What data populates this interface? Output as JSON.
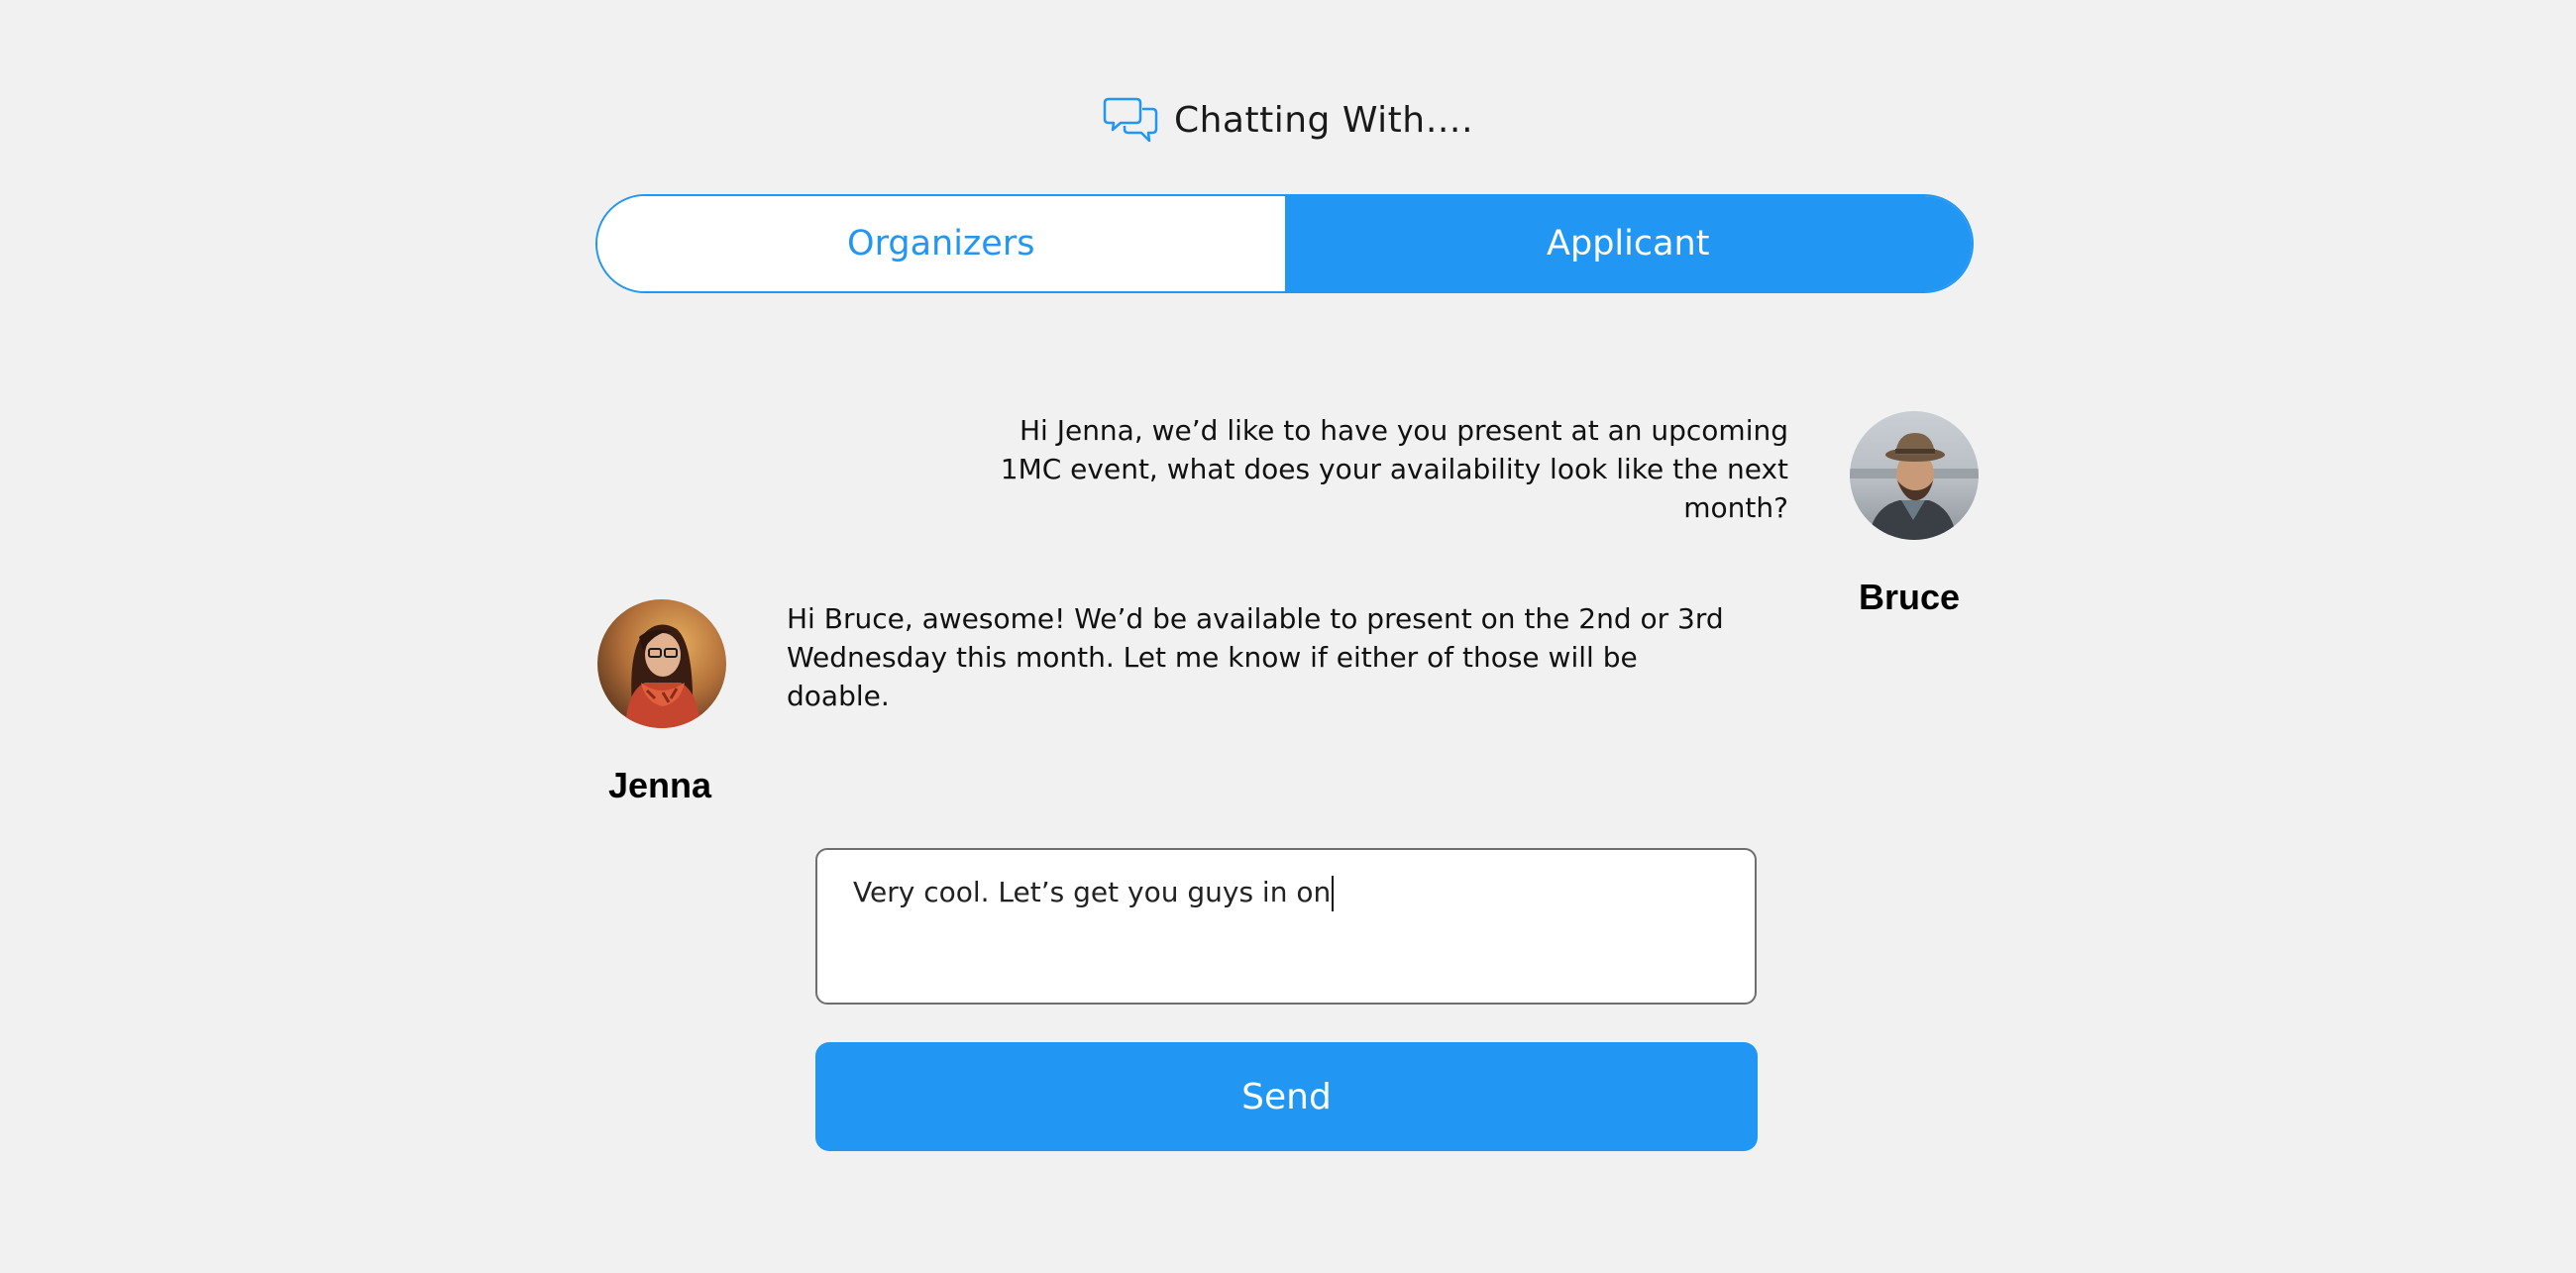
{
  "header": {
    "icon": "chat-bubbles-icon",
    "title": "Chatting With…."
  },
  "tabs": [
    {
      "label": "Organizers",
      "selected": false
    },
    {
      "label": "Applicant",
      "selected": true
    }
  ],
  "messages": [
    {
      "sender": "Bruce",
      "side": "right",
      "text": "Hi Jenna, we’d like to have you present at an upcoming 1MC event, what does your availability look like the next month?"
    },
    {
      "sender": "Jenna",
      "side": "left",
      "text": "Hi Bruce, awesome! We’d be available to present on the 2nd or 3rd Wednesday this month. Let me know if either of those will be doable."
    }
  ],
  "composer": {
    "value": "Very cool. Let’s get you guys in on",
    "send_label": "Send"
  },
  "colors": {
    "accent": "#2196f3",
    "background": "#f1f1f1"
  }
}
